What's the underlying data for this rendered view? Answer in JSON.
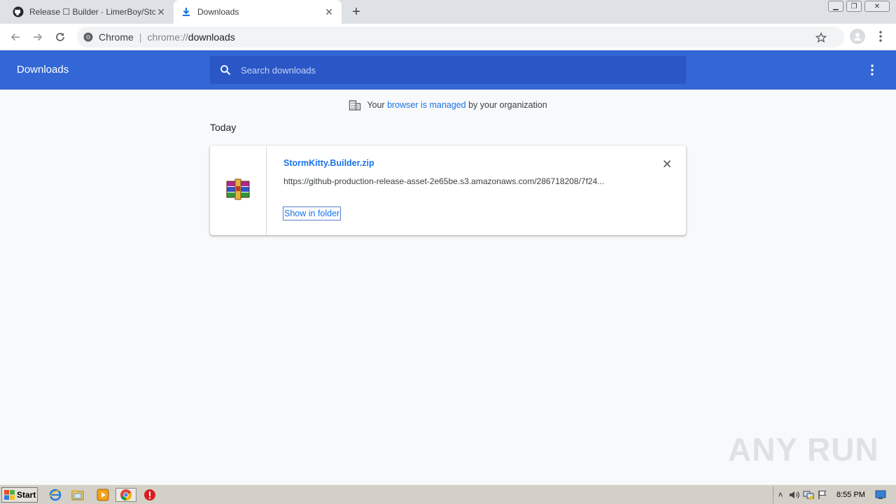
{
  "tabs": [
    {
      "title": "Release ☐ Builder · LimerBoy/StormKitty",
      "active": false,
      "icon": "github-icon"
    },
    {
      "title": "Downloads",
      "active": true,
      "icon": "download-icon"
    }
  ],
  "omnibox": {
    "site_label": "Chrome",
    "url_scheme": "chrome://",
    "url_host": "downloads"
  },
  "downloads_page": {
    "title": "Downloads",
    "search_placeholder": "Search downloads",
    "managed_prefix": "Your ",
    "managed_link": "browser is managed",
    "managed_suffix": " by your organization",
    "section_label": "Today"
  },
  "download_item": {
    "file_name": "StormKitty.Builder.zip",
    "url": "https://github-production-release-asset-2e65be.s3.amazonaws.com/286718208/7f24...",
    "action_label": "Show in folder",
    "icon": "winrar-archive-icon"
  },
  "watermark": {
    "text": "ANY RUN"
  },
  "taskbar": {
    "start_label": "Start",
    "clock": "8:55 PM"
  },
  "colors": {
    "header_blue": "#3367d6",
    "search_blue": "#2a56c6",
    "link_blue": "#1a73e8"
  }
}
